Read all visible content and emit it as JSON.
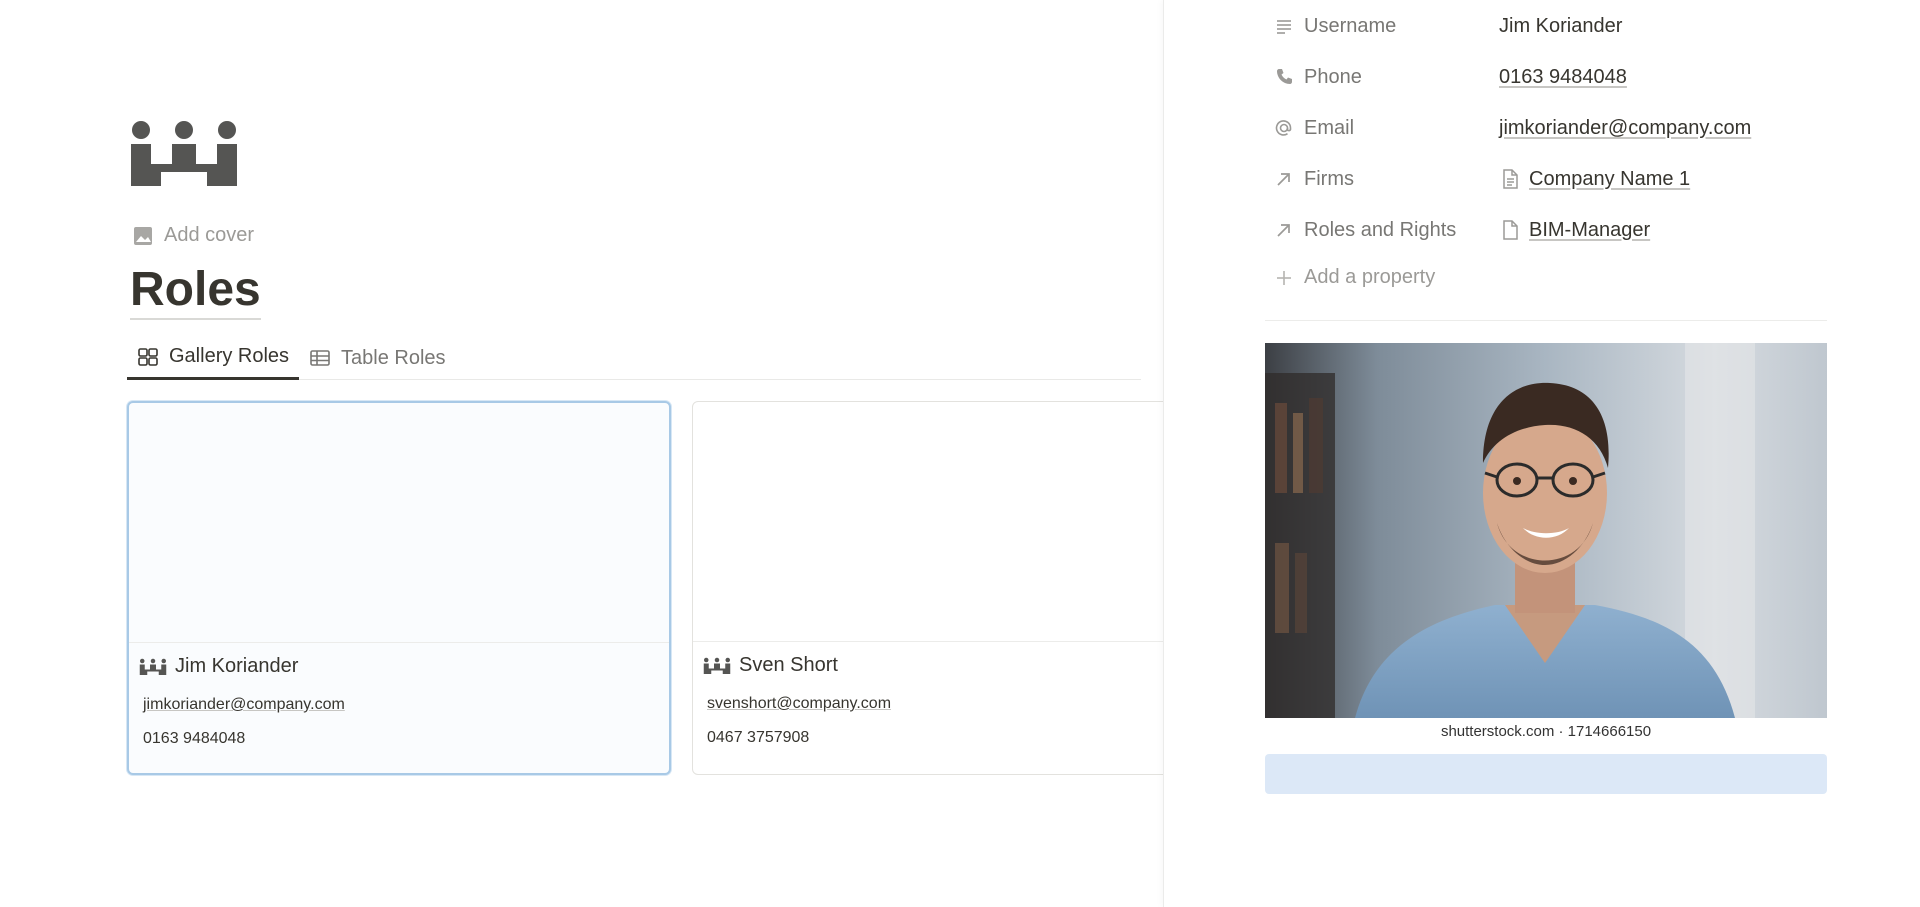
{
  "page": {
    "add_cover": "Add cover",
    "title": "Roles"
  },
  "tabs": [
    {
      "label": "Gallery Roles",
      "icon": "gallery-icon",
      "active": true
    },
    {
      "label": "Table Roles",
      "icon": "table-icon",
      "active": false
    }
  ],
  "cards": [
    {
      "name": "Jim Koriander",
      "email": "jimkoriander@company.com",
      "phone": "0163 9484048",
      "selected": true
    },
    {
      "name": "Sven Short",
      "email": "svenshort@company.com",
      "phone": "0467 3757908",
      "selected": false
    }
  ],
  "panel": {
    "properties": [
      {
        "label": "Username",
        "icon": "text-lines-icon",
        "value": "Jim Koriander"
      },
      {
        "label": "Phone",
        "icon": "phone-icon",
        "value": "0163 9484048"
      },
      {
        "label": "Email",
        "icon": "at-sign-icon",
        "value": "jimkoriander@company.com"
      },
      {
        "label": "Firms",
        "icon": "relation-arrow-icon",
        "value": "Company Name 1"
      },
      {
        "label": "Roles and Rights",
        "icon": "relation-arrow-icon",
        "value": "BIM-Manager"
      }
    ],
    "add_property": "Add a property",
    "photo_caption": "shutterstock.com · 1714666150"
  },
  "colors": {
    "text": "#37352f",
    "muted": "#787774",
    "selected_border": "#a8c9e6",
    "bar": "#dce8f7"
  }
}
